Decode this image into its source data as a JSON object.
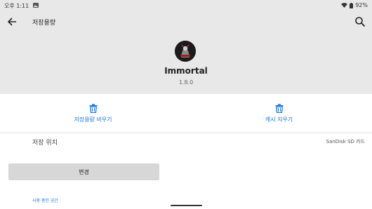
{
  "status_bar": {
    "time": "오후 1:11",
    "battery": "92%"
  },
  "toolbar": {
    "title": "저장용량"
  },
  "app": {
    "name": "Immortal",
    "version": "1.8.0"
  },
  "actions": {
    "clear_storage": "저장용량 비우기",
    "clear_cache": "캐시 지우기"
  },
  "storage": {
    "location_label": "저장 위치",
    "location_value": "SanDisk SD 카드",
    "change_button": "변경"
  },
  "usage": {
    "label": "사용 중인 공간"
  },
  "colors": {
    "accent": "#1a73e8",
    "header_bg": "#e8e8e8",
    "button_bg": "#d7d7d7"
  }
}
